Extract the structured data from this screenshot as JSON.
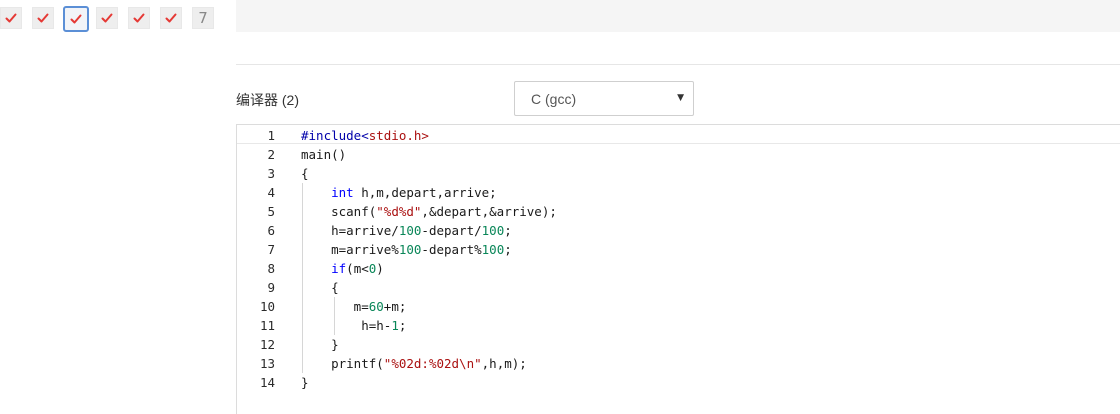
{
  "nav": {
    "items": [
      {
        "type": "check"
      },
      {
        "type": "check"
      },
      {
        "type": "check",
        "active": true
      },
      {
        "type": "check"
      },
      {
        "type": "check"
      },
      {
        "type": "check"
      },
      {
        "type": "number",
        "label": "7"
      }
    ],
    "check_color": "#e53935",
    "active_border": "#5b8fd6"
  },
  "compiler": {
    "label": "编译器 (2)",
    "selected": "C (gcc)"
  },
  "editor": {
    "lines": [
      "#include<stdio.h>",
      "main()",
      "{",
      "    int h,m,depart,arrive;",
      "    scanf(\"%d%d\",&depart,&arrive);",
      "    h=arrive/100-depart/100;",
      "    m=arrive%100-depart%100;",
      "    if(m<0)",
      "    {",
      "       m=60+m;",
      "        h=h-1;",
      "    }",
      "    printf(\"%02d:%02d\\n\",h,m);",
      "}"
    ]
  }
}
